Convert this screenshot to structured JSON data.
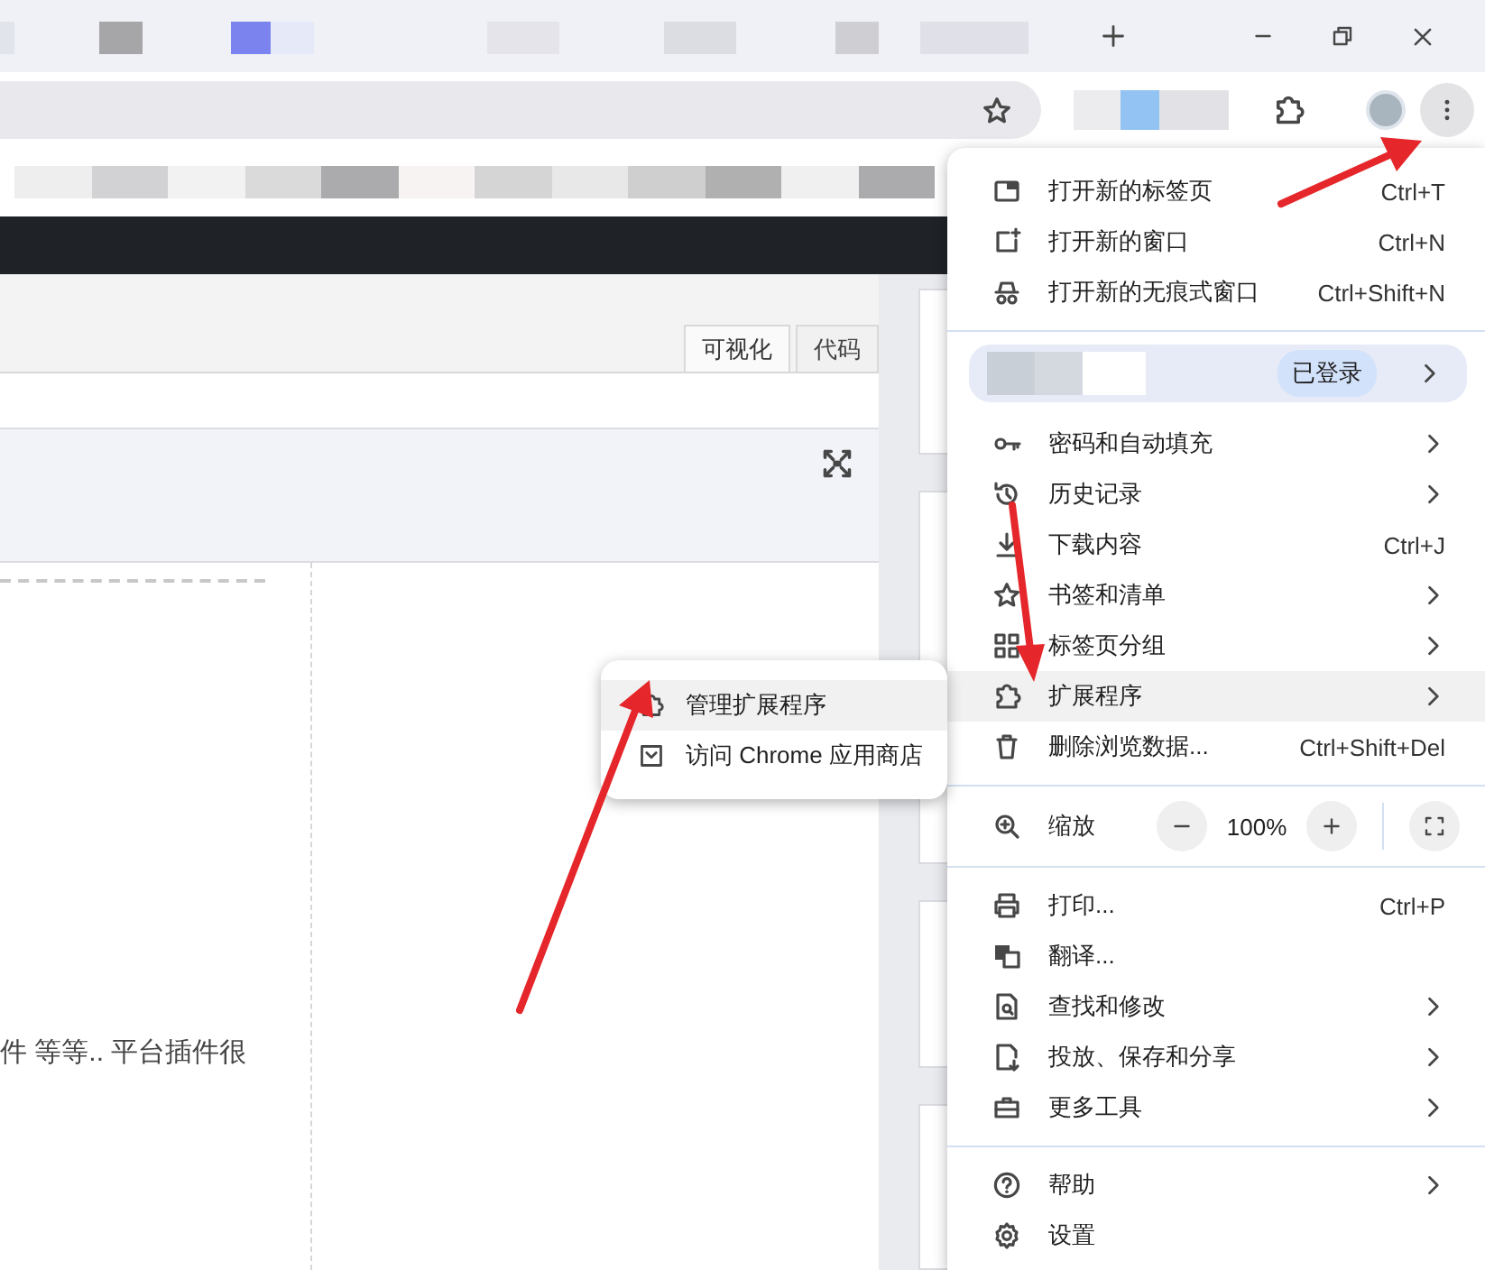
{
  "page": {
    "view_tabs": [
      {
        "label": "可视化",
        "selected": true
      },
      {
        "label": "代码",
        "selected": false
      }
    ],
    "body_text": "件 等等.. 平台插件很"
  },
  "menu": {
    "items": [
      {
        "kind": "item",
        "label": "打开新的标签页",
        "shortcut": "Ctrl+T",
        "has_submenu": false,
        "highlighted": false
      },
      {
        "kind": "item",
        "label": "打开新的窗口",
        "shortcut": "Ctrl+N",
        "has_submenu": false,
        "highlighted": false
      },
      {
        "kind": "item",
        "label": "打开新的无痕式窗口",
        "shortcut": "Ctrl+Shift+N",
        "has_submenu": false,
        "highlighted": false
      },
      {
        "kind": "separator"
      },
      {
        "kind": "profile",
        "badge": "已登录"
      },
      {
        "kind": "item",
        "label": "密码和自动填充",
        "has_submenu": true,
        "highlighted": false
      },
      {
        "kind": "item",
        "label": "历史记录",
        "has_submenu": true,
        "highlighted": false
      },
      {
        "kind": "item",
        "label": "下载内容",
        "shortcut": "Ctrl+J",
        "has_submenu": false,
        "highlighted": false
      },
      {
        "kind": "item",
        "label": "书签和清单",
        "has_submenu": true,
        "highlighted": false
      },
      {
        "kind": "item",
        "label": "标签页分组",
        "has_submenu": true,
        "highlighted": false
      },
      {
        "kind": "item",
        "label": "扩展程序",
        "has_submenu": true,
        "highlighted": true
      },
      {
        "kind": "item",
        "label": "删除浏览数据...",
        "shortcut": "Ctrl+Shift+Del",
        "has_submenu": false,
        "highlighted": false
      },
      {
        "kind": "separator"
      },
      {
        "kind": "zoom",
        "label": "缩放",
        "value": "100%"
      },
      {
        "kind": "separator"
      },
      {
        "kind": "item",
        "label": "打印...",
        "shortcut": "Ctrl+P",
        "has_submenu": false,
        "highlighted": false
      },
      {
        "kind": "item",
        "label": "翻译...",
        "has_submenu": false,
        "highlighted": false
      },
      {
        "kind": "item",
        "label": "查找和修改",
        "has_submenu": true,
        "highlighted": false
      },
      {
        "kind": "item",
        "label": "投放、保存和分享",
        "has_submenu": true,
        "highlighted": false
      },
      {
        "kind": "item",
        "label": "更多工具",
        "has_submenu": true,
        "highlighted": false
      },
      {
        "kind": "separator"
      },
      {
        "kind": "item",
        "label": "帮助",
        "has_submenu": true,
        "highlighted": false
      },
      {
        "kind": "item",
        "label": "设置",
        "has_submenu": false,
        "highlighted": false
      }
    ]
  },
  "submenu": {
    "items": [
      {
        "label": "管理扩展程序",
        "highlighted": true
      },
      {
        "label": "访问 Chrome 应用商店",
        "highlighted": false
      }
    ]
  }
}
